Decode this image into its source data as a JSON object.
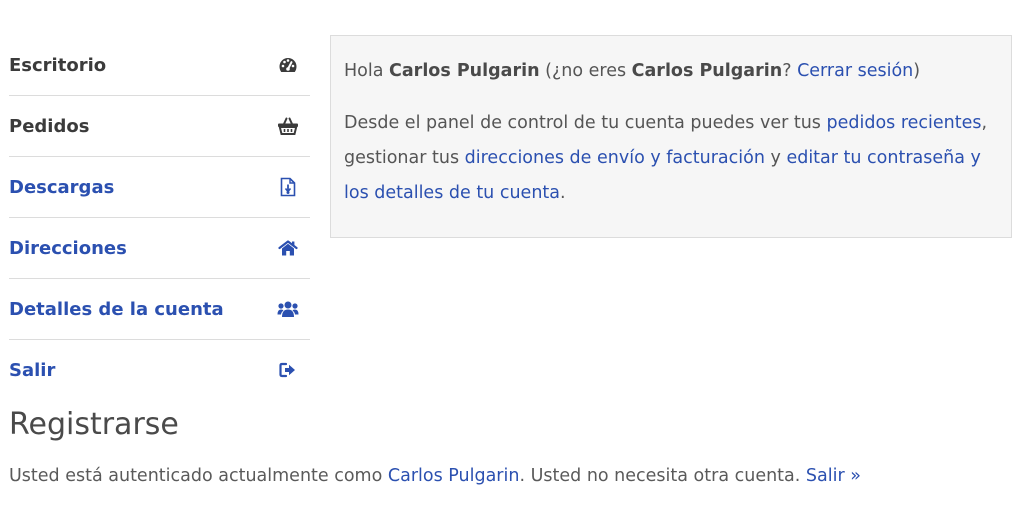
{
  "nav": {
    "items": [
      {
        "label": "Escritorio",
        "icon": "dashboard-gauge-icon"
      },
      {
        "label": "Pedidos",
        "icon": "shopping-basket-icon"
      },
      {
        "label": "Descargas",
        "icon": "file-download-icon"
      },
      {
        "label": "Direcciones",
        "icon": "home-icon"
      },
      {
        "label": "Detalles de la cuenta",
        "icon": "users-icon"
      },
      {
        "label": "Salir",
        "icon": "sign-out-icon"
      }
    ]
  },
  "welcome": {
    "hello": "Hola",
    "user": "Carlos Pulgarin",
    "not_you_prefix": "(¿no eres",
    "user_repeat": "Carlos Pulgarin",
    "question_mark": "?",
    "logout_link": "Cerrar sesión",
    "close_paren": ")"
  },
  "dashboard": {
    "text_1": "Desde el panel de control de tu cuenta puedes ver tus",
    "link_orders": "pedidos recientes",
    "text_2": ", gestionar tus",
    "link_addresses": "direcciones de envío y facturación",
    "text_3": "y",
    "link_account": "editar tu contraseña y los detalles de tu cuenta",
    "text_4": "."
  },
  "register": {
    "title": "Registrarse",
    "text_1": "Usted está autenticado actualmente como",
    "link_user": "Carlos Pulgarin",
    "text_2": ". Usted no necesita otra cuenta.",
    "link_logout": "Salir »"
  },
  "colors": {
    "link": "#2b50b0",
    "text": "#555555",
    "panel_bg": "#f6f6f6",
    "border": "#dcdcdc"
  }
}
